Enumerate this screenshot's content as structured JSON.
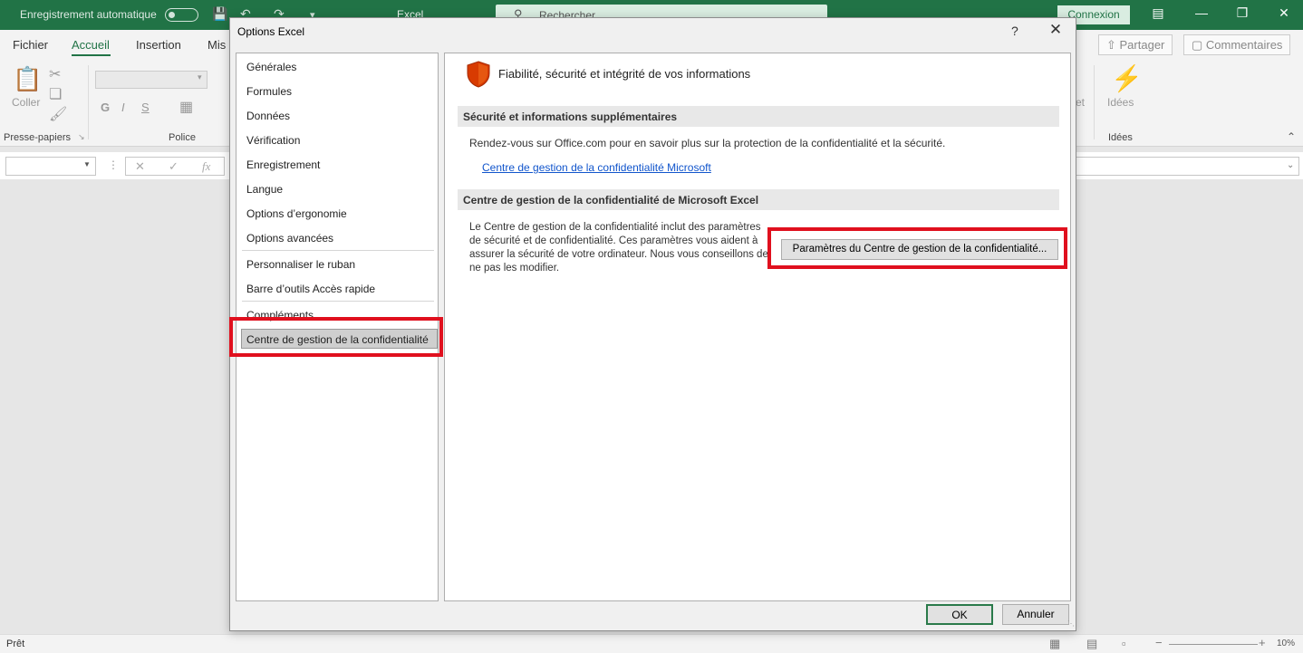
{
  "titlebar": {
    "autosave_label": "Enregistrement automatique",
    "app_title": "Excel",
    "search_placeholder": "Rechercher",
    "signin_label": "Connexion"
  },
  "ribbon_tabs": {
    "file": "Fichier",
    "home": "Accueil",
    "insert": "Insertion",
    "layout_partial": "Mis",
    "share": "Partager",
    "comments": "Commentaires"
  },
  "ribbon": {
    "paste_label": "Coller",
    "clipboard_group": "Presse-papiers",
    "font_group": "Police",
    "bold": "G",
    "italic": "I",
    "underline": "S",
    "ideas_label": "Idées",
    "ideas_group": "Idées",
    "partial_label": "et"
  },
  "formula_bar": {
    "fx": "fx"
  },
  "statusbar": {
    "ready": "Prêt",
    "zoom": "10%"
  },
  "dialog": {
    "title": "Options Excel",
    "help": "?",
    "nav": [
      "Générales",
      "Formules",
      "Données",
      "Vérification",
      "Enregistrement",
      "Langue",
      "Options d’ergonomie",
      "Options avancées",
      "Personnaliser le ruban",
      "Barre d’outils Accès rapide",
      "Compléments",
      "Centre de gestion de la confidentialité"
    ],
    "content": {
      "header": "Fiabilité, sécurité et intégrité de vos informations",
      "section1_title": "Sécurité et informations supplémentaires",
      "section1_text": "Rendez-vous sur Office.com pour en savoir plus sur la protection de la confidentialité et la sécurité.",
      "section1_link": "Centre de gestion de la confidentialité Microsoft",
      "section2_title": "Centre de gestion de la confidentialité de Microsoft Excel",
      "section2_text": "Le Centre de gestion de la confidentialité inclut des paramètres de sécurité et de confidentialité. Ces paramètres vous aident à assurer la sécurité de votre ordinateur. Nous vous conseillons de ne pas les modifier.",
      "trust_center_button": "Paramètres du Centre de gestion de la confidentialité..."
    },
    "ok": "OK",
    "cancel": "Annuler"
  },
  "colors": {
    "excel_green": "#217346",
    "highlight_red": "#e0101e",
    "link_blue": "#1155cc",
    "shield_orange": "#d83b01"
  }
}
